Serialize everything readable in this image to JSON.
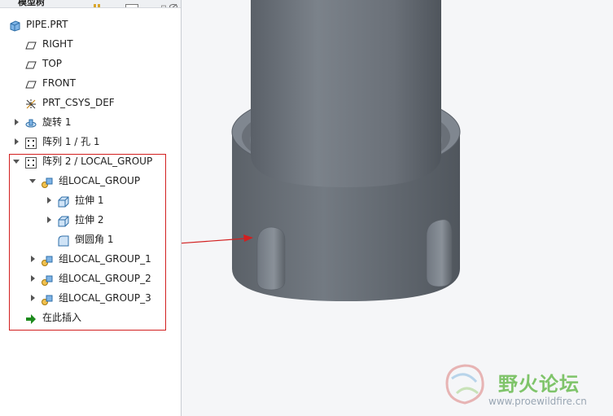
{
  "panel": {
    "title": "模型树"
  },
  "tree": {
    "items": [
      {
        "label": "PIPE.PRT",
        "icon": "part-icon"
      },
      {
        "label": "RIGHT",
        "icon": "datum-plane-icon"
      },
      {
        "label": "TOP",
        "icon": "datum-plane-icon"
      },
      {
        "label": "FRONT",
        "icon": "datum-plane-icon"
      },
      {
        "label": "PRT_CSYS_DEF",
        "icon": "csys-icon"
      },
      {
        "label": "旋转 1",
        "icon": "revolve-icon"
      },
      {
        "label": "阵列 1 / 孔 1",
        "icon": "pattern-icon"
      },
      {
        "label": "阵列 2 / LOCAL_GROUP",
        "icon": "pattern-icon"
      },
      {
        "label": "组LOCAL_GROUP",
        "icon": "group-icon"
      },
      {
        "label": "拉伸 1",
        "icon": "extrude-icon"
      },
      {
        "label": "拉伸 2",
        "icon": "extrude-icon"
      },
      {
        "label": "倒圆角 1",
        "icon": "round-icon"
      },
      {
        "label": "组LOCAL_GROUP_1",
        "icon": "group-icon"
      },
      {
        "label": "组LOCAL_GROUP_2",
        "icon": "group-icon"
      },
      {
        "label": "组LOCAL_GROUP_3",
        "icon": "group-icon"
      },
      {
        "label": "在此插入",
        "icon": "insert-here-icon"
      }
    ]
  },
  "watermark": {
    "cn": "野火论坛",
    "url": "www.proewildfire.cn"
  },
  "colors": {
    "highlight_box": "#d21f1f",
    "model_gray": "#6f757c",
    "insert_arrow": "#1d8a1d"
  }
}
